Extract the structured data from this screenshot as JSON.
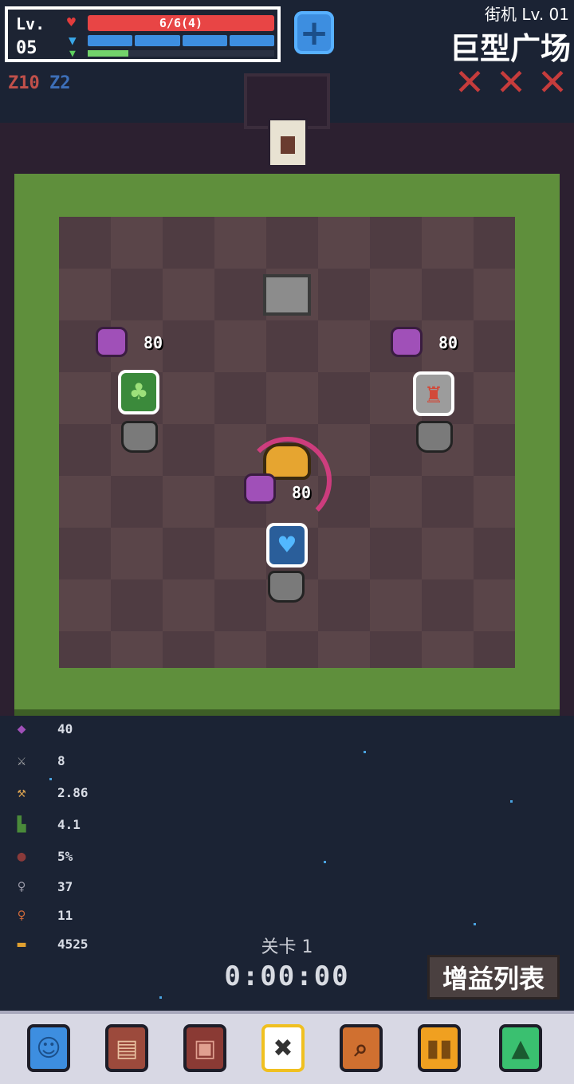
{
  "hud": {
    "level_label": "Lv.",
    "level_value": "05",
    "hp_text": "6/6(4)",
    "shield_segments": 4,
    "xp_fraction": 0.22,
    "plus_icon": "plus-icon"
  },
  "buffs": [
    {
      "icon": "red-z-10-icon",
      "label": "Z10",
      "color": "#c0504a"
    },
    {
      "icon": "blue-z-2-icon",
      "label": "Z2",
      "color": "#3d6fb8"
    }
  ],
  "mode": {
    "label": "街机 Lv. 01",
    "map_name": "巨型广场"
  },
  "failed_marks": 3,
  "shop": {
    "items": [
      {
        "name": "clover",
        "price": "80",
        "icon": "clover-icon"
      },
      {
        "name": "tower",
        "price": "80",
        "icon": "tower-icon"
      },
      {
        "name": "heart",
        "price": "80",
        "icon": "blue-heart-icon"
      }
    ]
  },
  "stats": [
    {
      "icon": "crystal-icon",
      "value": "40"
    },
    {
      "icon": "crossed-swords-icon",
      "value": "8"
    },
    {
      "icon": "sword-icon",
      "value": "2.86"
    },
    {
      "icon": "boot-icon",
      "value": "4.1"
    },
    {
      "icon": "shield-icon",
      "value": "5%"
    },
    {
      "icon": "grey-key-icon",
      "value": "37"
    },
    {
      "icon": "orange-key-icon",
      "value": "11"
    },
    {
      "icon": "gold-icon",
      "value": "4525"
    }
  ],
  "stage_label": "关卡 1",
  "timer": "0:00:00",
  "buff_list_button": "增益列表",
  "toolbar": [
    {
      "icon": "character-icon",
      "color": "#3d8ee0"
    },
    {
      "icon": "scroll-icon",
      "color": "#9c4a3c"
    },
    {
      "icon": "backpack-icon",
      "color": "#8a3a34"
    },
    {
      "icon": "skull-target-icon",
      "color": "#f0c020"
    },
    {
      "icon": "magnifier-icon",
      "color": "#d07030"
    },
    {
      "icon": "pause-icon",
      "color": "#f0a020"
    },
    {
      "icon": "up-arrow-icon",
      "color": "#3ac070"
    }
  ]
}
